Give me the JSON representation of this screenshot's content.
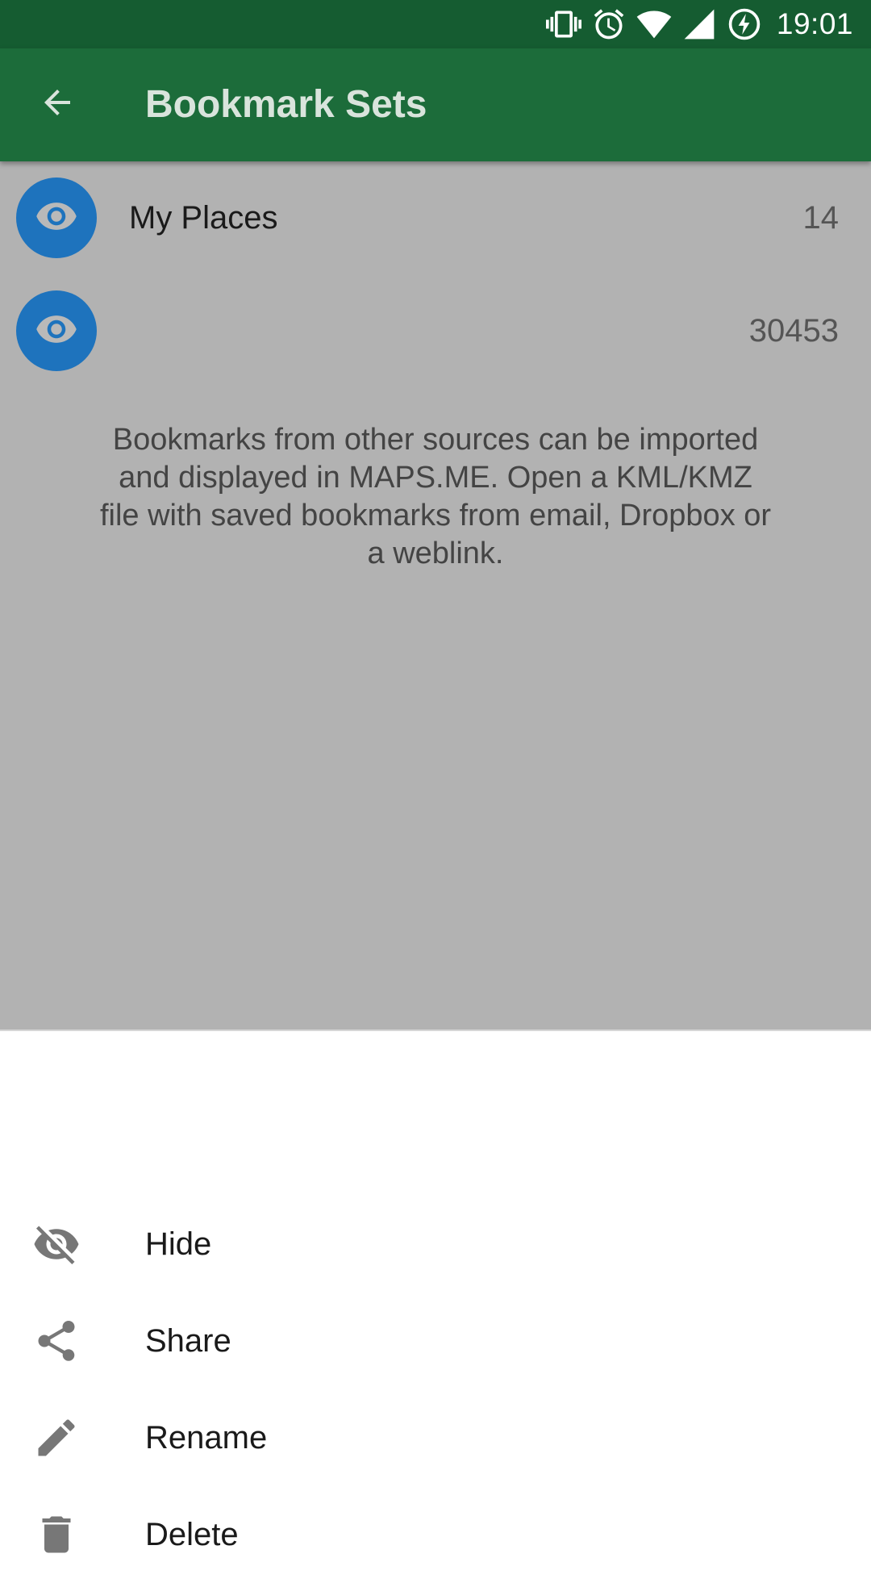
{
  "status_bar": {
    "time": "19:01",
    "icons": [
      "vibrate-icon",
      "alarm-icon",
      "wifi-icon",
      "signal-icon",
      "battery-charging-icon"
    ]
  },
  "toolbar": {
    "title": "Bookmark Sets",
    "back_icon": "arrow-back-icon"
  },
  "bookmark_sets": [
    {
      "name": "My Places",
      "count": "14",
      "visible": true,
      "icon": "eye-icon"
    },
    {
      "name": "",
      "count": "30453",
      "visible": true,
      "icon": "eye-icon"
    }
  ],
  "help_text": "Bookmarks from other sources can be imported and displayed in MAPS.ME. Open a KML/KMZ file with saved bookmarks from email, Dropbox or a weblink.",
  "bottom_sheet": {
    "items": [
      {
        "label": "Hide",
        "icon": "eye-off-icon"
      },
      {
        "label": "Share",
        "icon": "share-icon"
      },
      {
        "label": "Rename",
        "icon": "pencil-icon"
      },
      {
        "label": "Delete",
        "icon": "trash-icon"
      }
    ]
  },
  "colors": {
    "status_bar": "#155c31",
    "toolbar": "#1c6c3a",
    "scrim": "#b2b2b2",
    "eye_button": "#1e73bd",
    "menu_icon": "#777777"
  }
}
